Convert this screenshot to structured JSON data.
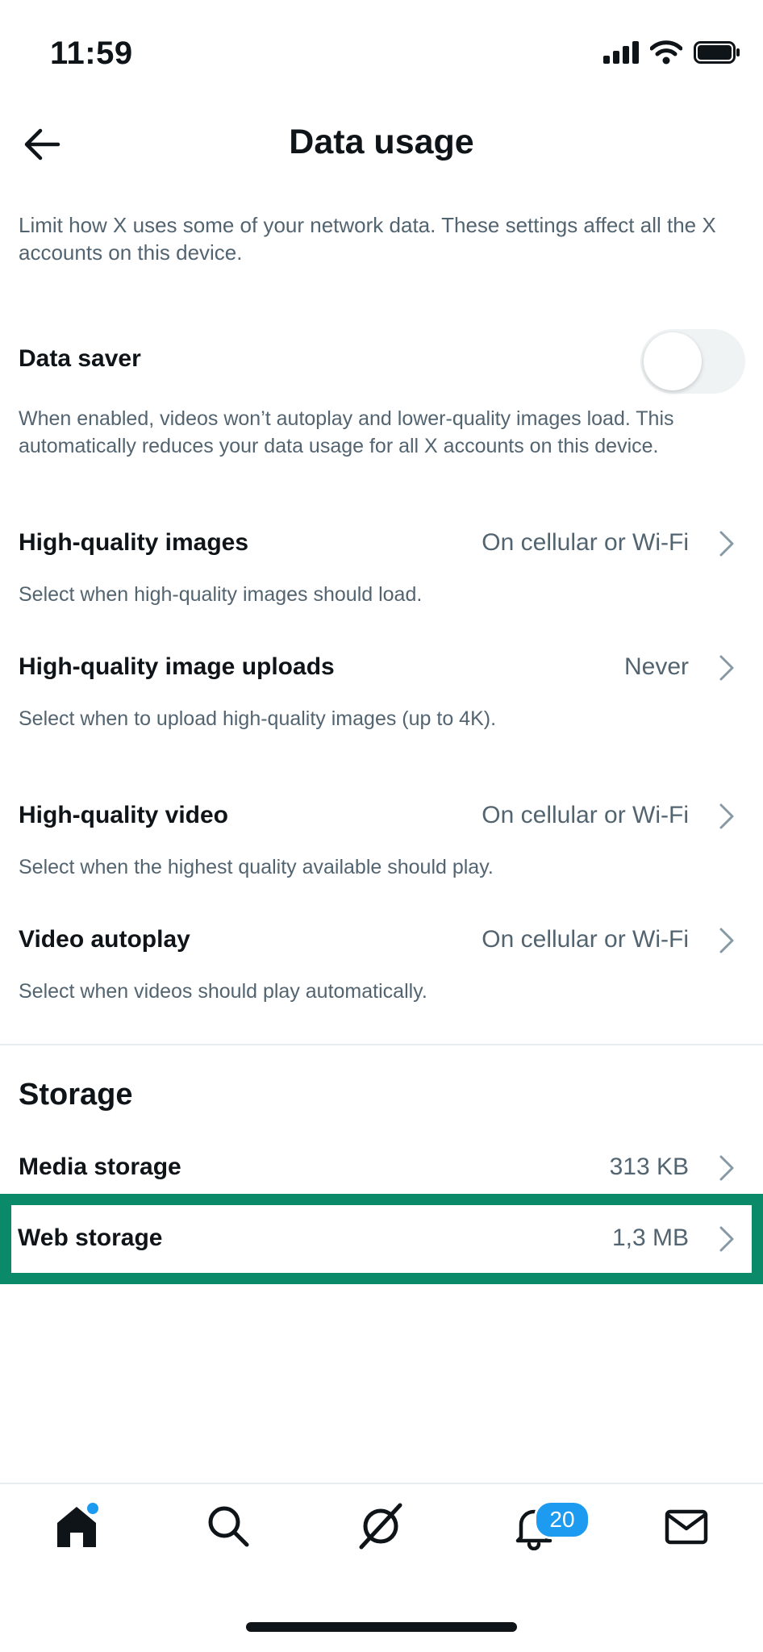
{
  "status_bar": {
    "time": "11:59"
  },
  "header": {
    "title": "Data usage"
  },
  "intro": "Limit how X uses some of your network data. These settings affect all the X accounts on this device.",
  "data_saver": {
    "label": "Data saver",
    "enabled": false,
    "description": "When enabled, videos won’t autoplay and lower-quality images load. This automatically reduces your data usage for all X accounts on this device."
  },
  "settings": [
    {
      "label": "High-quality images",
      "value": "On cellular or Wi-Fi",
      "description": "Select when high-quality images should load."
    },
    {
      "label": "High-quality image uploads",
      "value": "Never",
      "description": "Select when to upload high-quality images (up to 4K)."
    },
    {
      "label": "High-quality video",
      "value": "On cellular or Wi-Fi",
      "description": "Select when the highest quality available should play."
    },
    {
      "label": "Video autoplay",
      "value": "On cellular or Wi-Fi",
      "description": "Select when videos should play automatically."
    }
  ],
  "storage": {
    "title": "Storage",
    "items": [
      {
        "label": "Media storage",
        "value": "313 KB"
      },
      {
        "label": "Web storage",
        "value": "1,3 MB"
      }
    ]
  },
  "bottom_nav": {
    "items": [
      "home-icon",
      "search-icon",
      "grok-icon",
      "notifications-icon",
      "messages-icon"
    ],
    "notifications_badge": "20"
  },
  "colors": {
    "accent": "#1d9bf0",
    "highlight": "#0b8a6a",
    "text": "#0f1419",
    "secondary": "#536471"
  }
}
